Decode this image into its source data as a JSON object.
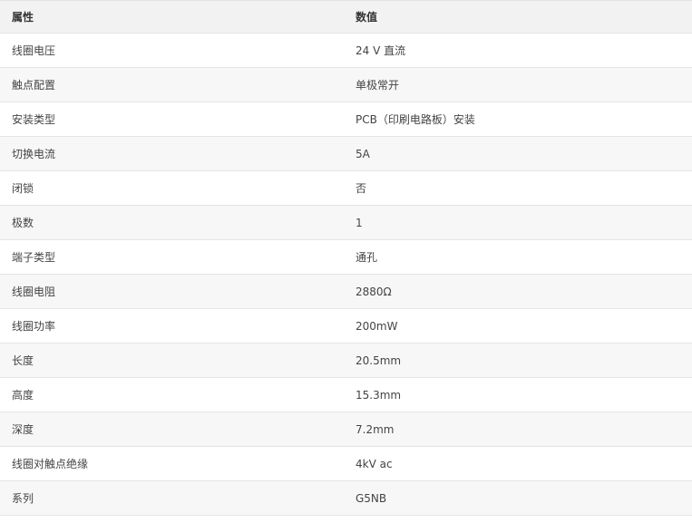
{
  "table": {
    "headers": {
      "property": "属性",
      "value": "数值"
    },
    "rows": [
      {
        "property": "线圈电压",
        "value": "24 V 直流"
      },
      {
        "property": "触点配置",
        "value": "单极常开"
      },
      {
        "property": "安装类型",
        "value": "PCB（印刷电路板）安装"
      },
      {
        "property": "切换电流",
        "value": "5A"
      },
      {
        "property": "闭锁",
        "value": "否"
      },
      {
        "property": "极数",
        "value": "1"
      },
      {
        "property": "端子类型",
        "value": "通孔"
      },
      {
        "property": "线圈电阻",
        "value": "2880Ω"
      },
      {
        "property": "线圈功率",
        "value": "200mW"
      },
      {
        "property": "长度",
        "value": "20.5mm"
      },
      {
        "property": "高度",
        "value": "15.3mm"
      },
      {
        "property": "深度",
        "value": "7.2mm"
      },
      {
        "property": "线圈对触点绝缘",
        "value": "4kV ac"
      },
      {
        "property": "系列",
        "value": "G5NB"
      }
    ]
  }
}
